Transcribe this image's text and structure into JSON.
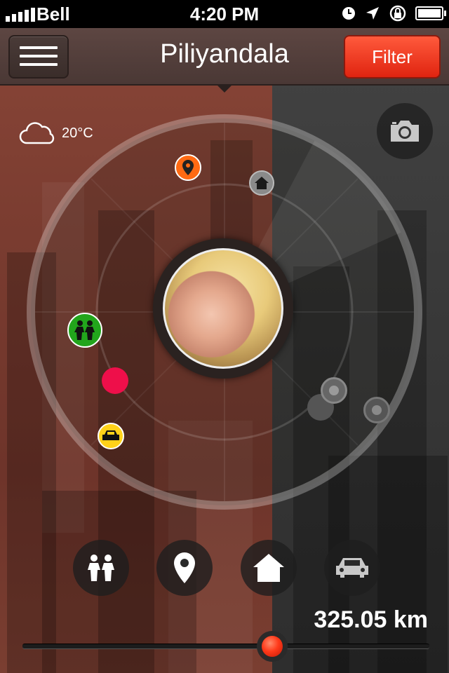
{
  "status": {
    "carrier": "Bell",
    "time": "4:20 PM",
    "signal_bars": 5
  },
  "nav": {
    "title": "Piliyandala",
    "filter_label": "Filter",
    "menu_icon": "hamburger-icon"
  },
  "weather": {
    "icon": "cloud-icon",
    "temperature": "20°C"
  },
  "camera": {
    "icon": "camera-icon"
  },
  "profile": {
    "name": "",
    "avatar": "profile-photo"
  },
  "map_pins": [
    {
      "type": "location",
      "color": "#ff6a13"
    },
    {
      "type": "home",
      "color": "#8a8a8a"
    },
    {
      "type": "people",
      "color": "#22a51c"
    },
    {
      "type": "poi",
      "color": "#ee0f4a"
    },
    {
      "type": "car",
      "color": "#ffd21a"
    },
    {
      "type": "inactive",
      "color": "#555555"
    },
    {
      "type": "inactive",
      "color": "#666666"
    },
    {
      "type": "inactive",
      "color": "#555555"
    }
  ],
  "categories": [
    {
      "icon": "people-icon"
    },
    {
      "icon": "location-pin-icon"
    },
    {
      "icon": "home-icon"
    },
    {
      "icon": "car-icon"
    }
  ],
  "distance": {
    "label": "325.05 km",
    "slider_fraction": 0.61
  },
  "colors": {
    "accent": "#ff3a1a",
    "left_tint": "#7a3c30",
    "right_tint": "#3a3a3a"
  }
}
